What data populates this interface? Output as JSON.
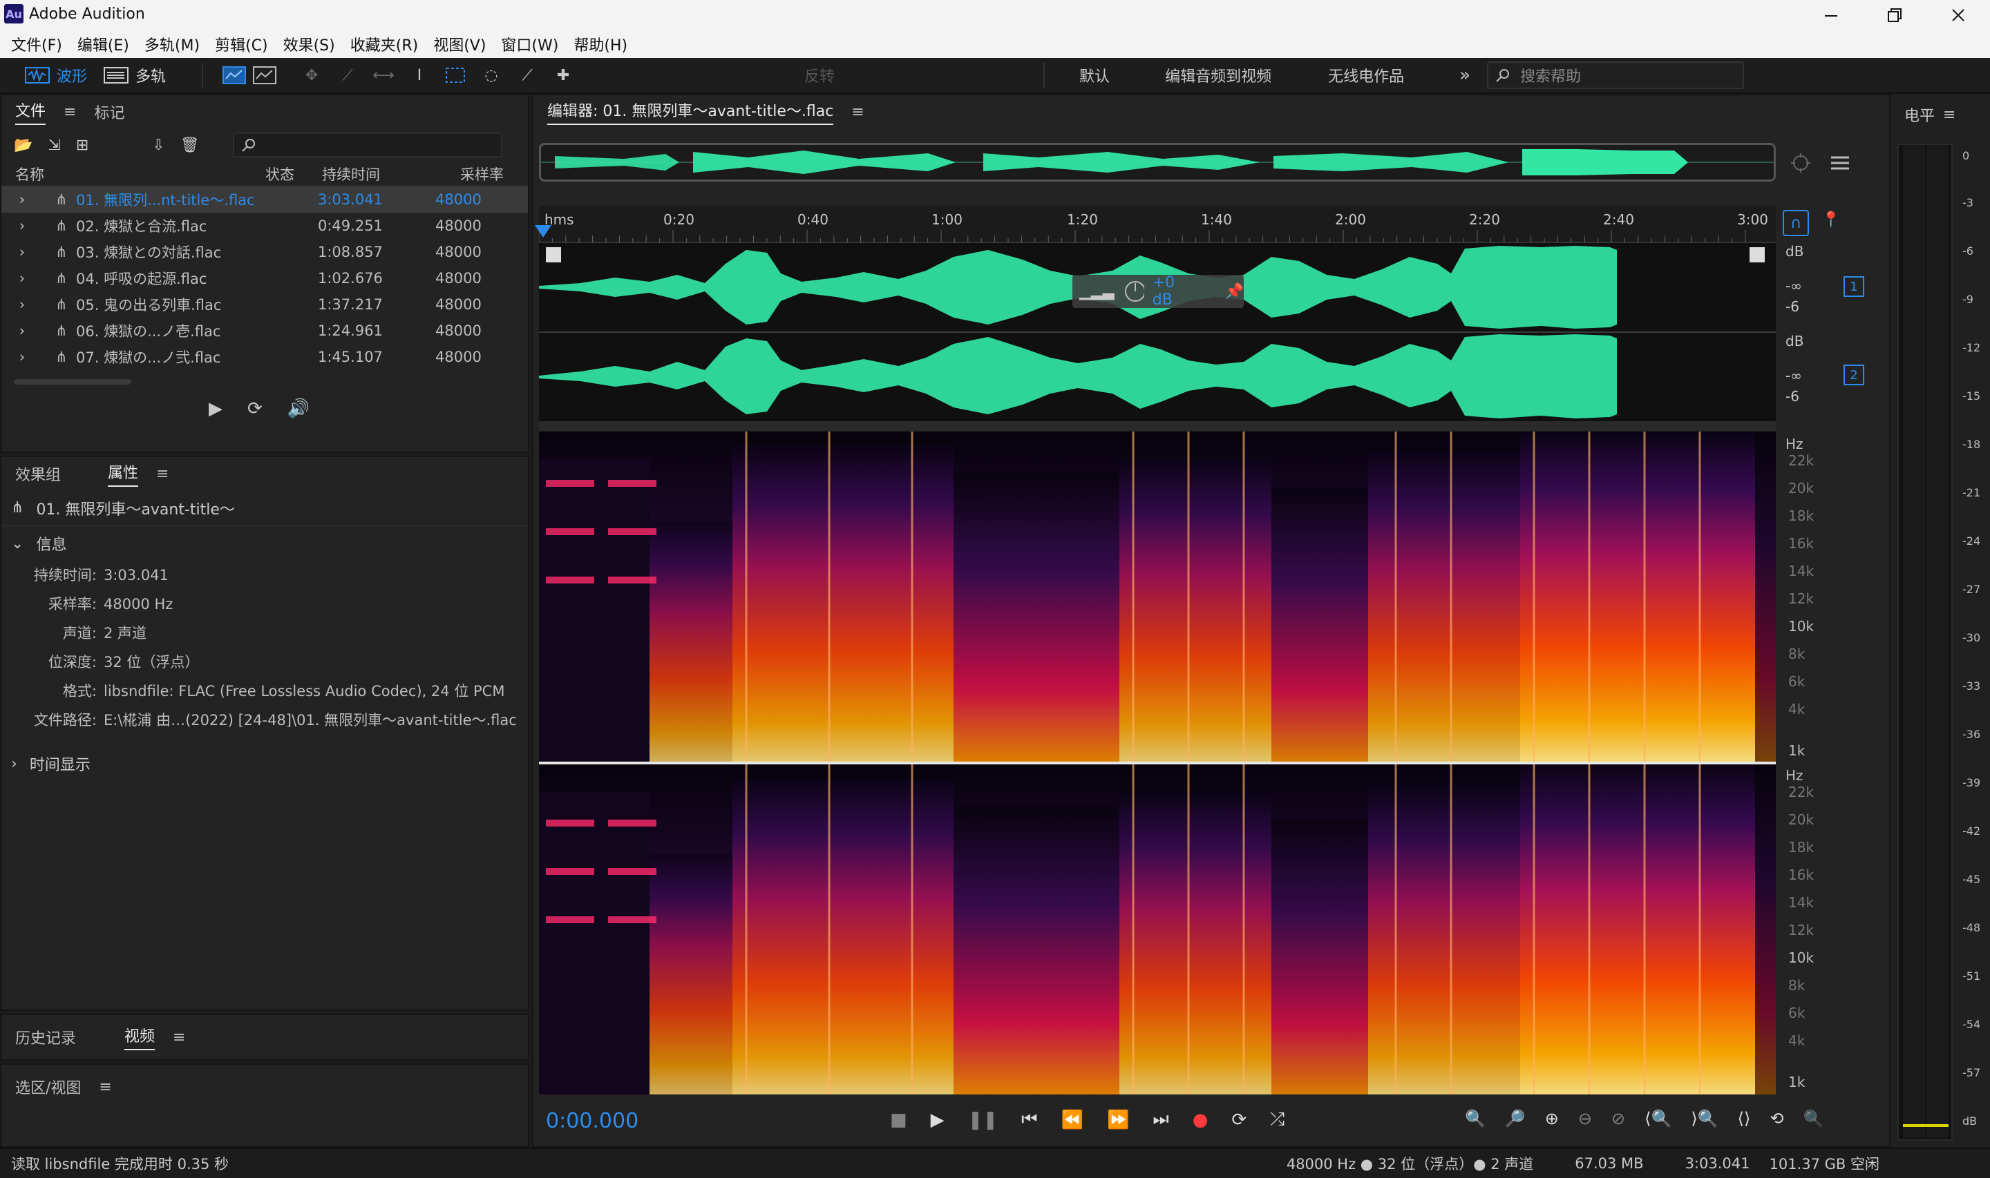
{
  "window": {
    "title": "Adobe Audition",
    "app_icon_text": "Au"
  },
  "menu": [
    "文件(F)",
    "编辑(E)",
    "多轨(M)",
    "剪辑(C)",
    "效果(S)",
    "收藏夹(R)",
    "视图(V)",
    "窗口(W)",
    "帮助(H)"
  ],
  "toolbar": {
    "waveform_label": "波形",
    "multitrack_label": "多轨",
    "invert_label": "反转",
    "workspaces": [
      "默认",
      "编辑音频到视频",
      "无线电作品"
    ],
    "search_placeholder": "搜索帮助"
  },
  "files_panel": {
    "tabs": [
      "文件",
      "标记"
    ],
    "columns": [
      "名称",
      "状态",
      "持续时间",
      "采样率"
    ],
    "rows": [
      {
        "name": "01. 無限列...nt-title～.flac",
        "duration": "3:03.041",
        "rate": "48000"
      },
      {
        "name": "02. 煉獄と合流.flac",
        "duration": "0:49.251",
        "rate": "48000"
      },
      {
        "name": "03. 煉獄との対話.flac",
        "duration": "1:08.857",
        "rate": "48000"
      },
      {
        "name": "04. 呼吸の起源.flac",
        "duration": "1:02.676",
        "rate": "48000"
      },
      {
        "name": "05. 鬼の出る列車.flac",
        "duration": "1:37.217",
        "rate": "48000"
      },
      {
        "name": "06. 煉獄の...ノ壱.flac",
        "duration": "1:24.961",
        "rate": "48000"
      },
      {
        "name": "07. 煉獄の...ノ弐.flac",
        "duration": "1:45.107",
        "rate": "48000"
      }
    ]
  },
  "properties_panel": {
    "tabs": [
      "效果组",
      "属性"
    ],
    "file_title": "01. 無限列車～avant-title～",
    "info_header": "信息",
    "info": [
      {
        "k": "持续时间:",
        "v": "3:03.041"
      },
      {
        "k": "采样率:",
        "v": "48000 Hz"
      },
      {
        "k": "声道:",
        "v": "2 声道"
      },
      {
        "k": "位深度:",
        "v": "32 位（浮点）"
      },
      {
        "k": "格式:",
        "v": "libsndfile: FLAC (Free Lossless Audio Codec), 24 位 PCM"
      },
      {
        "k": "文件路径:",
        "v": "E:\\椛浦 由…(2022) [24-48]\\01. 無限列車～avant-title～.flac"
      }
    ],
    "time_display_header": "时间显示"
  },
  "bottom_left": {
    "tabs": [
      "历史记录",
      "视频"
    ],
    "selection_view": "选区/视图"
  },
  "editor": {
    "title": "编辑器: 01. 無限列車～avant-title～.flac",
    "ruler_labels": [
      "hms",
      "0:20",
      "0:40",
      "1:00",
      "1:20",
      "1:40",
      "2:00",
      "2:20",
      "2:40",
      "3:00"
    ],
    "gain_label": "+0 dB",
    "db_labels_ch1": [
      "dB",
      "-∞",
      "-6"
    ],
    "db_labels_ch2": [
      "dB",
      "-∞",
      "-6"
    ],
    "channel_badges": [
      "1",
      "2"
    ],
    "hz_labels": [
      "Hz",
      "22k",
      "20k",
      "18k",
      "16k",
      "14k",
      "12k",
      "10k",
      "8k",
      "6k",
      "4k",
      "1k"
    ],
    "current_time": "0:00.000"
  },
  "level_meter": {
    "title": "电平",
    "scale": [
      "0",
      "-3",
      "-6",
      "-9",
      "-12",
      "-15",
      "-18",
      "-21",
      "-24",
      "-27",
      "-30",
      "-33",
      "-36",
      "-39",
      "-42",
      "-45",
      "-48",
      "-51",
      "-54",
      "-57",
      "dB"
    ]
  },
  "status": {
    "left": "读取 libsndfile 完成用时 0.35 秒",
    "sample": "48000 Hz ● 32 位（浮点）● 2 声道",
    "size": "67.03 MB",
    "duration": "3:03.041",
    "free": "101.37 GB 空闲"
  },
  "colors": {
    "accent_blue": "#2d8ceb",
    "wave_green": "#32e6a4"
  }
}
